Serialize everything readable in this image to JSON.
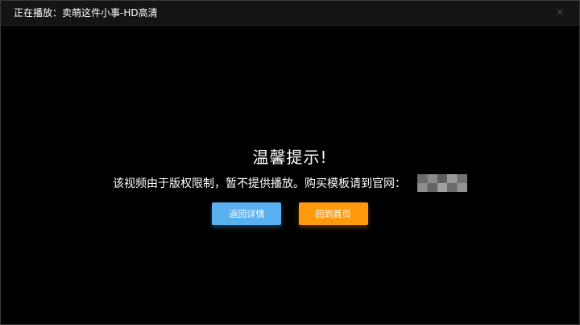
{
  "window": {
    "title": "正在播放：卖萌这件小事-HD高清",
    "close_icon": "close-icon",
    "close_glyph": "×"
  },
  "notice": {
    "title": "温馨提示!",
    "message": "该视频由于版权限制，暂不提供播放。购买模板请到官网："
  },
  "buttons": {
    "details_label": "返回详情",
    "home_label": "回到首页"
  },
  "colors": {
    "background": "#000000",
    "titlebar": "#141414",
    "details_button": "#5bb0f0",
    "home_button": "#ff9a0e",
    "text": "#ffffff"
  }
}
